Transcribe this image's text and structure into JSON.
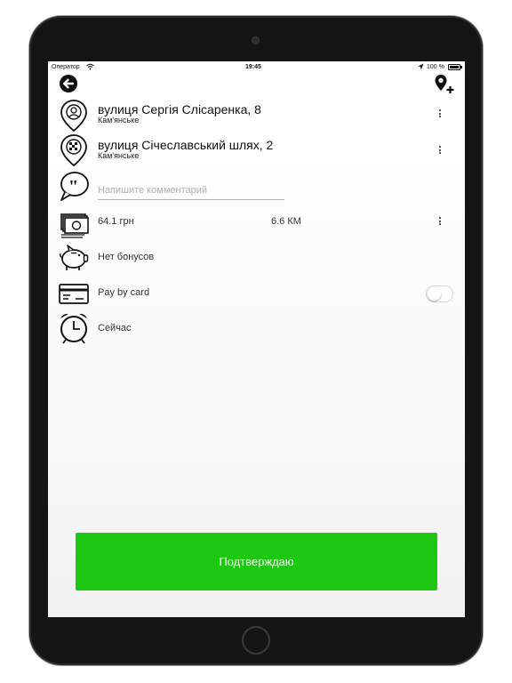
{
  "status_bar": {
    "carrier": "Оператор",
    "time": "19:45",
    "battery": "100 %"
  },
  "header": {
    "back_icon": "back-arrow-circle-icon",
    "add_location_icon": "add-location-pin-icon"
  },
  "route": {
    "from": {
      "street": "вулиця Сергія Слісаренка, 8",
      "city": "Кам'янське",
      "icon": "pin-start-icon"
    },
    "to": {
      "street": "вулиця Січеславський шлях, 2",
      "city": "Кам'янське",
      "icon": "pin-finish-flag-icon"
    }
  },
  "comment": {
    "placeholder": "Напишите комментарий",
    "value": "",
    "icon": "quote-bubble-icon"
  },
  "price": {
    "amount": "64.1 грн",
    "distance": "6.6 КМ",
    "icon": "money-bills-icon"
  },
  "bonuses": {
    "label": "Нет бонусов",
    "icon": "piggy-bank-icon"
  },
  "payment": {
    "label": "Pay by card",
    "card_enabled": false,
    "icon": "credit-card-icon"
  },
  "time_option": {
    "label": "Сейчас",
    "icon": "alarm-clock-icon"
  },
  "confirm": {
    "label": "Подтверждаю",
    "color": "#1ec711"
  }
}
